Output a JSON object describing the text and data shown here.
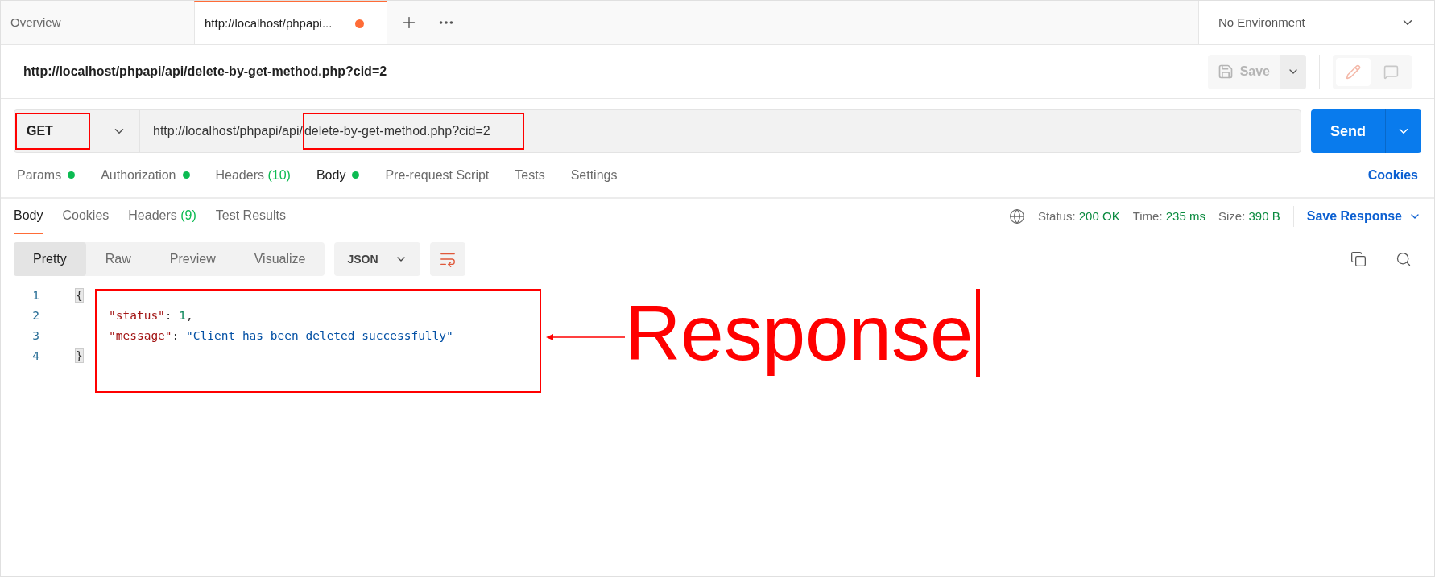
{
  "tabs": [
    {
      "label": "Overview",
      "selected": false,
      "unsaved": false
    },
    {
      "label": "http://localhost/phpapi...",
      "selected": true,
      "unsaved": true
    }
  ],
  "environment": "No Environment",
  "request_title": "http://localhost/phpapi/api/delete-by-get-method.php?cid=2",
  "save_button": "Save",
  "method": "GET",
  "url": {
    "prefix": "http://localhost/phpapi/api/",
    "highlighted": "delete-by-get-method.php?cid=2"
  },
  "send_button": "Send",
  "edit_toggle": [
    {
      "kind": "edit",
      "selected": true
    },
    {
      "kind": "comment",
      "selected": false
    }
  ],
  "request_tabs": [
    {
      "label": "Params",
      "dot": true,
      "selected": false
    },
    {
      "label": "Authorization",
      "dot": true,
      "selected": false
    },
    {
      "label": "Headers",
      "count": "(10)",
      "dot": false,
      "selected": false
    },
    {
      "label": "Body",
      "dot": true,
      "selected": true
    },
    {
      "label": "Pre-request Script",
      "dot": false,
      "selected": false
    },
    {
      "label": "Tests",
      "dot": false,
      "selected": false
    },
    {
      "label": "Settings",
      "dot": false,
      "selected": false
    }
  ],
  "cookies_link": "Cookies",
  "response_tabs": [
    {
      "label": "Body",
      "selected": true
    },
    {
      "label": "Cookies",
      "selected": false
    },
    {
      "label": "Headers",
      "count": "(9)",
      "selected": false
    },
    {
      "label": "Test Results",
      "selected": false
    }
  ],
  "response_stats": [
    {
      "label": "Status:",
      "value": "200 OK"
    },
    {
      "label": "Time:",
      "value": "235 ms"
    },
    {
      "label": "Size:",
      "value": "390 B"
    }
  ],
  "save_response": "Save Response",
  "view_modes": [
    {
      "label": "Pretty",
      "selected": true
    },
    {
      "label": "Raw",
      "selected": false
    },
    {
      "label": "Preview",
      "selected": false
    },
    {
      "label": "Visualize",
      "selected": false
    }
  ],
  "format": "JSON",
  "code_lines": [
    {
      "number": "1",
      "tokens": [
        {
          "kind": "bracket",
          "text": "{"
        }
      ]
    },
    {
      "number": "2",
      "tokens": [
        {
          "kind": "key",
          "text": "\"status\""
        },
        {
          "kind": "punct",
          "text": ": "
        },
        {
          "kind": "number",
          "text": "1"
        },
        {
          "kind": "punct",
          "text": ","
        }
      ]
    },
    {
      "number": "3",
      "tokens": [
        {
          "kind": "key",
          "text": "\"message\""
        },
        {
          "kind": "punct",
          "text": ": "
        },
        {
          "kind": "string",
          "text": "\"Client has been deleted successfully\""
        }
      ]
    },
    {
      "number": "4",
      "tokens": [
        {
          "kind": "bracket",
          "text": "}"
        }
      ]
    }
  ],
  "annotation": "Response"
}
